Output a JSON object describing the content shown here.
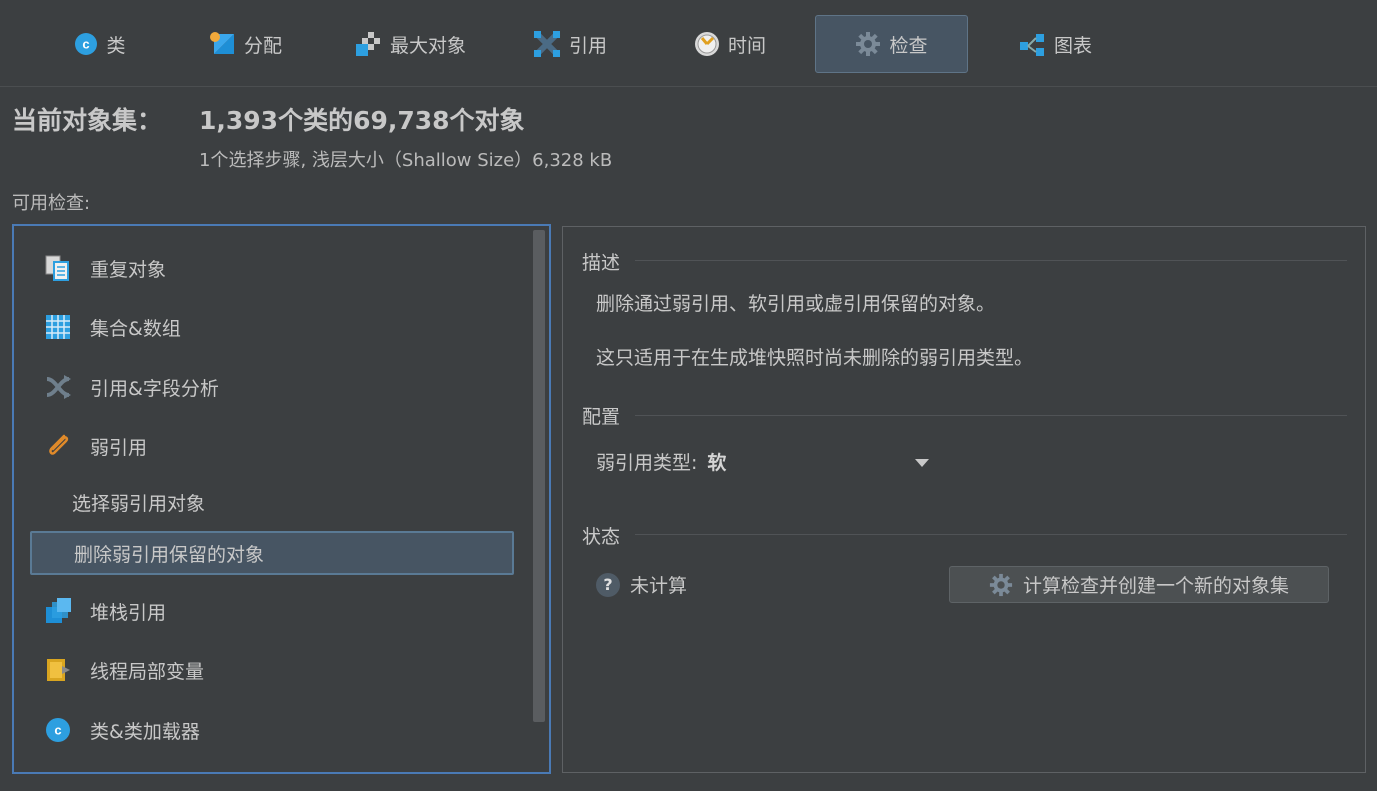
{
  "tabs": [
    {
      "label": "类",
      "icon": "class-icon"
    },
    {
      "label": "分配",
      "icon": "allocation-icon"
    },
    {
      "label": "最大对象",
      "icon": "biggest-objects-icon"
    },
    {
      "label": "引用",
      "icon": "references-icon"
    },
    {
      "label": "时间",
      "icon": "time-icon"
    },
    {
      "label": "检查",
      "icon": "gear-icon",
      "active": true
    },
    {
      "label": "图表",
      "icon": "graph-icon"
    }
  ],
  "summary": {
    "label": "当前对象集：",
    "main": "1,393个类的69,738个对象",
    "sub": "1个选择步骤, 浅层大小（Shallow Size）6,328 kB"
  },
  "available_label": "可用检查:",
  "inspections": [
    {
      "label": "重复对象",
      "icon": "duplicate-objects-icon"
    },
    {
      "label": "集合&数组",
      "icon": "collections-arrays-icon"
    },
    {
      "label": "引用&字段分析",
      "icon": "reference-field-analysis-icon"
    },
    {
      "label": "弱引用",
      "icon": "weak-reference-icon"
    },
    {
      "label": "选择弱引用对象",
      "sub": true
    },
    {
      "label": "删除弱引用保留的对象",
      "sub": true,
      "selected": true
    },
    {
      "label": "堆栈引用",
      "icon": "stack-references-icon"
    },
    {
      "label": "线程局部变量",
      "icon": "thread-local-icon"
    },
    {
      "label": "类&类加载器",
      "icon": "class-loader-icon"
    }
  ],
  "detail": {
    "description_title": "描述",
    "description_lines": [
      "删除通过弱引用、软引用或虚引用保留的对象。",
      "这只适用于在生成堆快照时尚未删除的弱引用类型。"
    ],
    "config_title": "配置",
    "config_label": "弱引用类型:",
    "config_value": "软",
    "status_title": "状态",
    "status_text": "未计算",
    "calc_button": "计算检查并创建一个新的对象集"
  },
  "colors": {
    "background": "#3c3f41",
    "accent": "#4a7ab5",
    "selected": "#475563"
  }
}
